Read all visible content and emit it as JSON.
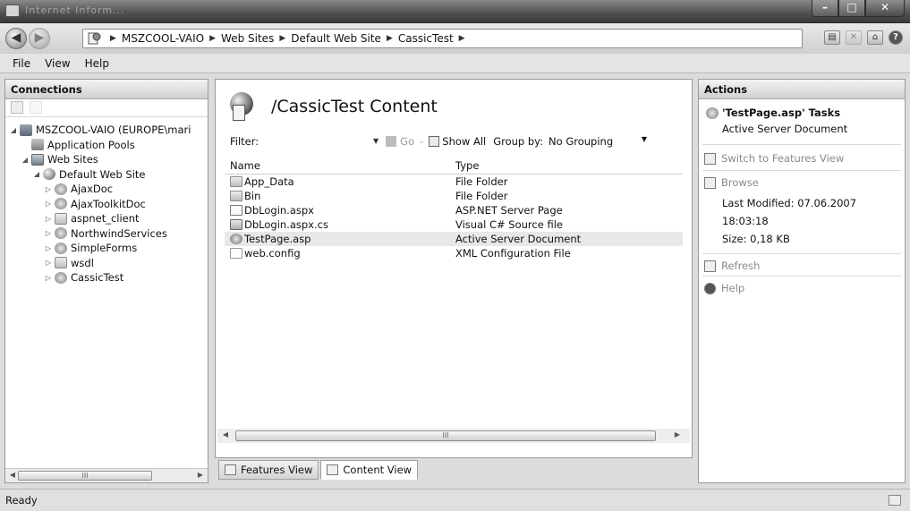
{
  "window": {
    "title": "Internet Inform..."
  },
  "address": {
    "crumbs": [
      "MSZCOOL-VAIO",
      "Web Sites",
      "Default Web Site",
      "CassicTest"
    ]
  },
  "menu": [
    "File",
    "View",
    "Help"
  ],
  "connections": {
    "header": "Connections",
    "tree": [
      {
        "label": "MSZCOOL-VAIO (EUROPE\\mari",
        "level": 0,
        "toggle": "expanded",
        "icon": "server-icon"
      },
      {
        "label": "Application Pools",
        "level": 1,
        "toggle": "none",
        "icon": "app-pool-icon"
      },
      {
        "label": "Web Sites",
        "level": 1,
        "toggle": "expanded",
        "icon": "web-sites-icon"
      },
      {
        "label": "Default Web Site",
        "level": 2,
        "toggle": "expanded",
        "icon": "globe-icon"
      },
      {
        "label": "AjaxDoc",
        "level": 3,
        "toggle": "collapsed",
        "icon": "application-icon"
      },
      {
        "label": "AjaxToolkitDoc",
        "level": 3,
        "toggle": "collapsed",
        "icon": "application-icon"
      },
      {
        "label": "aspnet_client",
        "level": 3,
        "toggle": "collapsed",
        "icon": "folder-icon"
      },
      {
        "label": "NorthwindServices",
        "level": 3,
        "toggle": "collapsed",
        "icon": "application-icon"
      },
      {
        "label": "SimpleForms",
        "level": 3,
        "toggle": "collapsed",
        "icon": "application-icon"
      },
      {
        "label": "wsdl",
        "level": 3,
        "toggle": "collapsed",
        "icon": "folder-icon"
      },
      {
        "label": "CassicTest",
        "level": 3,
        "toggle": "collapsed",
        "icon": "application-icon"
      }
    ]
  },
  "content": {
    "title": "/CassicTest Content",
    "filter_label": "Filter:",
    "go_label": "Go",
    "show_all_label": "Show All",
    "group_by_label": "Group by:",
    "group_by_value": "No Grouping",
    "columns": [
      "Name",
      "Type"
    ],
    "rows": [
      {
        "name": "App_Data",
        "type": "File Folder",
        "icon": "folder-icon"
      },
      {
        "name": "Bin",
        "type": "File Folder",
        "icon": "folder-icon"
      },
      {
        "name": "DbLogin.aspx",
        "type": "ASP.NET Server Page",
        "icon": "aspx-page-icon"
      },
      {
        "name": "DbLogin.aspx.cs",
        "type": "Visual C# Source file",
        "icon": "csharp-file-icon"
      },
      {
        "name": "TestPage.asp",
        "type": "Active Server Document",
        "icon": "asp-document-icon",
        "selected": true
      },
      {
        "name": "web.config",
        "type": "XML Configuration File",
        "icon": "config-file-icon"
      }
    ]
  },
  "view_tabs": [
    "Features View",
    "Content View"
  ],
  "actions": {
    "header": "Actions",
    "task_title": "'TestPage.asp' Tasks",
    "task_subtitle": "Active Server Document",
    "switch_label": "Switch to Features View",
    "browse_label": "Browse",
    "last_modified": "Last Modified: 07.06.2007 18:03:18",
    "size": "Size: 0,18 KB",
    "refresh_label": "Refresh",
    "help_label": "Help"
  },
  "status": {
    "text": "Ready"
  }
}
